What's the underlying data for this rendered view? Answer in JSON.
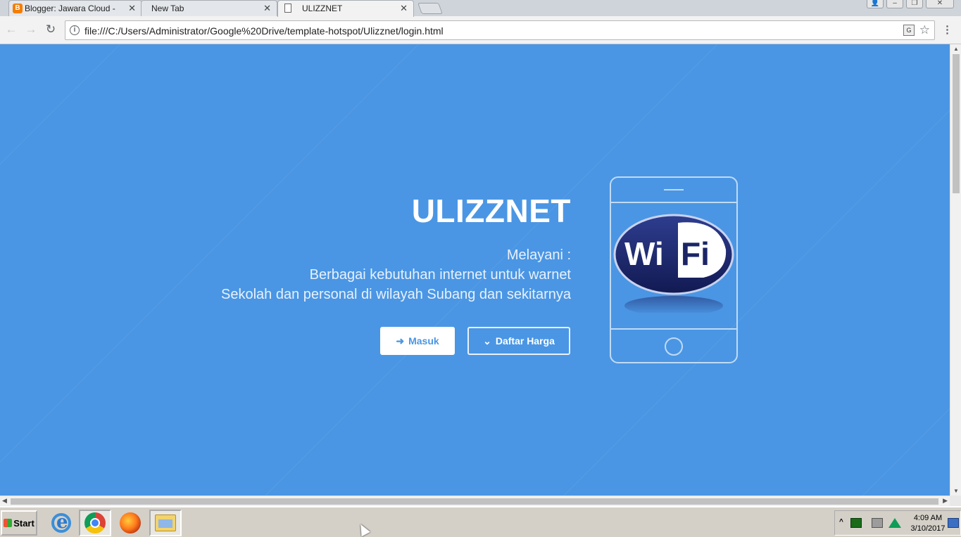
{
  "browser": {
    "tabs": [
      {
        "title": "Blogger: Jawara Cloud - Ed",
        "favicon": "blogger-icon"
      },
      {
        "title": "New Tab",
        "favicon": ""
      },
      {
        "title": "ULIZZNET",
        "favicon": "document-icon",
        "active": true
      }
    ],
    "url": "file:///C:/Users/Administrator/Google%20Drive/template-hotspot/Ulizznet/login.html"
  },
  "hero": {
    "title": "ULIZZNET",
    "line1": "Melayani :",
    "line2": "Berbagai kebutuhan internet untuk warnet",
    "line3": "Sekolah dan personal di wilayah Subang dan sekitarnya",
    "btn_login": "Masuk",
    "btn_prices": "Daftar Harga",
    "logo_text_left": "Wi",
    "logo_text_right": "Fi"
  },
  "taskbar": {
    "start_label": "Start",
    "time": "4:09 AM",
    "date": "3/10/2017"
  },
  "colors": {
    "page_background": "#4a96e4",
    "button_text": "#4a96e4"
  }
}
